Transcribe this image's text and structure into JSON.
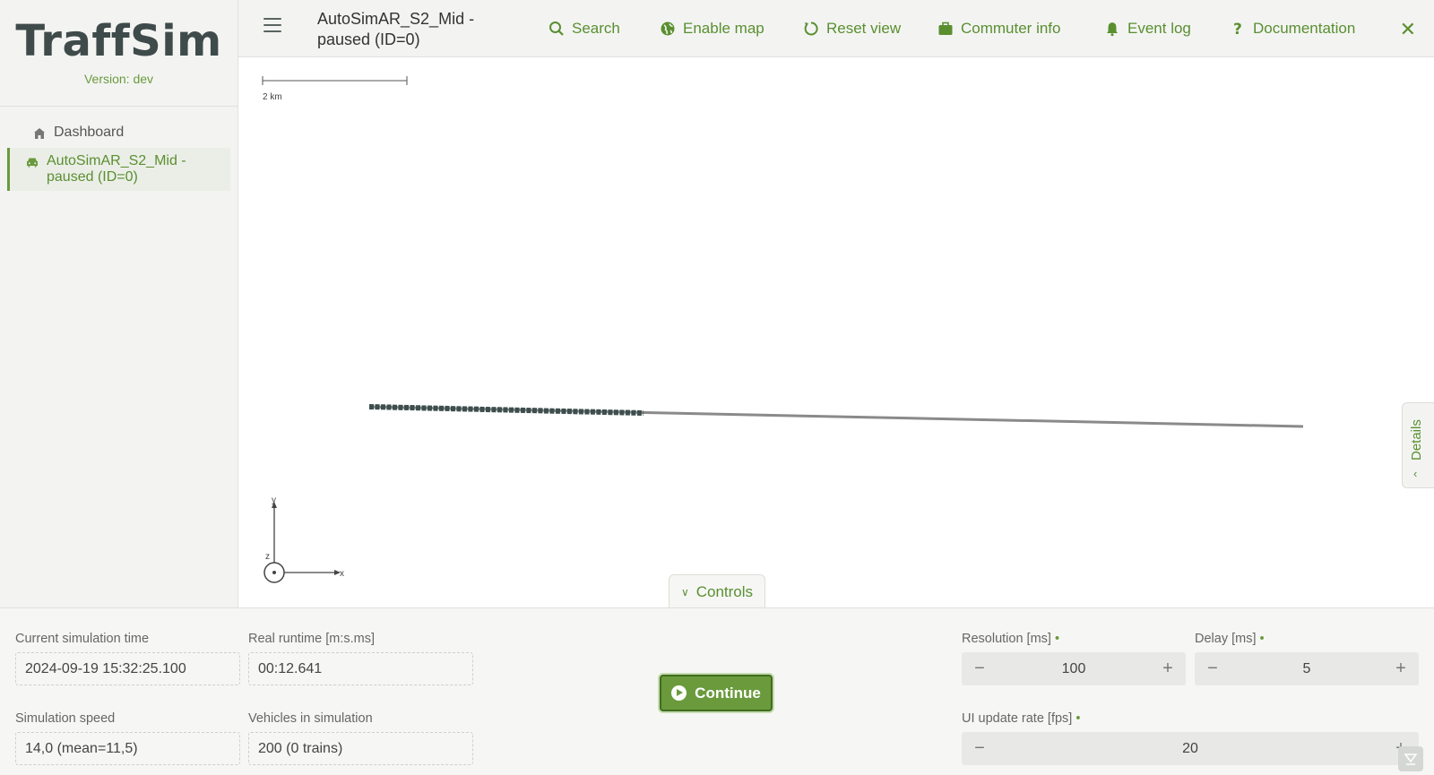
{
  "app": {
    "name": "TraffSim",
    "version": "Version: dev"
  },
  "sidebar": {
    "items": [
      {
        "label": "Dashboard",
        "icon": "home-icon",
        "active": false
      },
      {
        "label": "AutoSimAR_S2_Mid - paused (ID=0)",
        "icon": "car-icon",
        "active": true
      }
    ]
  },
  "header": {
    "title": "AutoSimAR_S2_Mid - paused (ID=0)",
    "actions": {
      "search": "Search",
      "enable_map": "Enable map",
      "reset_view": "Reset view",
      "commuter_info": "Commuter info",
      "event_log": "Event log",
      "documentation": "Documentation"
    },
    "close": "✕"
  },
  "map": {
    "scale_label": "2 km",
    "axes": {
      "x": "x",
      "y": "y",
      "z": "z"
    },
    "details_tab": "Details",
    "controls_tab": "Controls"
  },
  "controls": {
    "current_time": {
      "label": "Current simulation time",
      "value": "2024-09-19 15:32:25.100"
    },
    "real_runtime": {
      "label": "Real runtime [m:s.ms]",
      "value": "00:12.641"
    },
    "sim_speed": {
      "label": "Simulation speed",
      "value": "14,0 (mean=11,5)"
    },
    "vehicles": {
      "label": "Vehicles in simulation",
      "value": "200 (0 trains)"
    },
    "continue_label": "Continue",
    "resolution": {
      "label": "Resolution [ms]",
      "value": "100",
      "dot": "•"
    },
    "delay": {
      "label": "Delay [ms]",
      "value": "5",
      "dot": "•"
    },
    "ui_rate": {
      "label": "UI update rate [fps]",
      "value": "20",
      "dot": "•"
    },
    "minus": "−",
    "plus": "+"
  },
  "colors": {
    "accent": "#6a9a3c",
    "logo": "#3e4b4a",
    "panel_bg": "#f6f7f5"
  }
}
